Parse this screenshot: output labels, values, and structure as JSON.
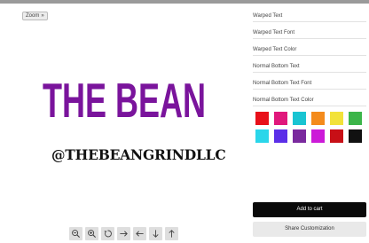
{
  "zoom_badge": {
    "label": "Zoom",
    "caret": "»"
  },
  "design": {
    "warped_text": "THE BEAN",
    "warped_color": "#7a149c",
    "bottom_text": "@THEBEANGRINDLLC",
    "bottom_color": "#111111"
  },
  "toolbar_icons": [
    "zoom-out-icon",
    "zoom-in-icon",
    "rotate-icon",
    "arrow-right-icon",
    "arrow-left-icon",
    "arrow-down-icon",
    "arrow-up-icon"
  ],
  "panel": {
    "fields": [
      {
        "label": "Warped Text"
      },
      {
        "label": "Warped Text Font"
      },
      {
        "label": "Warped Text Color"
      },
      {
        "label": "Normal Bottom Text"
      },
      {
        "label": "Normal Bottom Text Font"
      },
      {
        "label": "Normal Bottom Text Color"
      }
    ],
    "swatches": [
      "#e8101a",
      "#e0187c",
      "#19c4d2",
      "#f48b1c",
      "#f2e23a",
      "#3cb54a",
      "#2ad6ea",
      "#5b2ee8",
      "#7a2a9e",
      "#cc1ad8",
      "#c80f16",
      "#111111"
    ],
    "add_to_cart": "Add to cart",
    "share": "Share Customization"
  }
}
